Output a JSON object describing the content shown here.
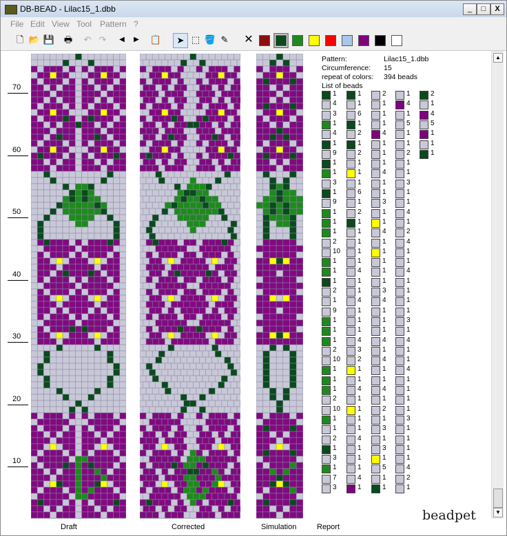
{
  "window": {
    "title": "DB-BEAD - Lilac15_1.dbb",
    "minimize": "_",
    "maximize": "□",
    "close": "X"
  },
  "menu": [
    "File",
    "Edit",
    "View",
    "Tool",
    "Pattern",
    "?"
  ],
  "toolbar": {
    "icons": [
      "new-file-icon",
      "open-folder-icon",
      "save-icon",
      "print-icon",
      "undo-icon",
      "redo-icon",
      "arrow-left-icon",
      "arrow-right-icon",
      "clipboard-icon",
      "pointer-icon",
      "select-rect-icon",
      "fill-bucket-icon",
      "color-picker-icon",
      "delete-icon"
    ],
    "palette": [
      "#8b0f0f",
      "#0a4a1e",
      "#1e8a1e",
      "#ffff00",
      "#ff0000",
      "#a9c7ee",
      "#800080",
      "#000000",
      "#ffffff"
    ],
    "selected_palette": 1
  },
  "ruler": {
    "labels": [
      "70",
      "60",
      "50",
      "40",
      "30",
      "20",
      "10"
    ]
  },
  "panels": {
    "draft": "Draft",
    "corrected": "Corrected",
    "simulation": "Simulation",
    "report": "Report"
  },
  "colors": {
    "background": "#c8c8d8",
    "grid": "#8a8aa0",
    "violet": "#800a80",
    "yellow": "#ffff00",
    "dark_green": "#0a4a1e",
    "green": "#1e8a1e"
  },
  "report": {
    "pattern_label": "Pattern:",
    "pattern_value": "Lilac15_1.dbb",
    "circumference_label": "Circumference:",
    "circumference_value": "15",
    "repeat_label": "repeat of colors:",
    "repeat_value": "394 beads",
    "list_label": "List of beads",
    "bead_columns": [
      [
        [
          "D",
          1
        ],
        [
          "L",
          4
        ],
        [
          "L",
          3
        ],
        [
          "G",
          1
        ],
        [
          "L",
          4
        ],
        [
          "D",
          1
        ],
        [
          "L",
          9
        ],
        [
          "D",
          1
        ],
        [
          "G",
          1
        ],
        [
          "L",
          3
        ],
        [
          "D",
          1
        ],
        [
          "L",
          9
        ],
        [
          "G",
          1
        ],
        [
          "G",
          1
        ],
        [
          "G",
          1
        ],
        [
          "L",
          2
        ],
        [
          "L",
          10
        ],
        [
          "G",
          1
        ],
        [
          "G",
          1
        ],
        [
          "D",
          1
        ],
        [
          "L",
          2
        ],
        [
          "L",
          1
        ],
        [
          "L",
          9
        ],
        [
          "G",
          1
        ],
        [
          "G",
          1
        ],
        [
          "G",
          1
        ],
        [
          "L",
          2
        ],
        [
          "L",
          10
        ],
        [
          "G",
          1
        ],
        [
          "G",
          1
        ],
        [
          "G",
          1
        ],
        [
          "L",
          2
        ],
        [
          "L",
          10
        ],
        [
          "G",
          1
        ],
        [
          "L",
          1
        ],
        [
          "L",
          2
        ],
        [
          "D",
          1
        ],
        [
          "L",
          3
        ],
        [
          "G",
          1
        ],
        [
          "L",
          7
        ],
        [
          "L",
          3
        ]
      ],
      [
        [
          "D",
          1
        ],
        [
          "L",
          1
        ],
        [
          "L",
          6
        ],
        [
          "D",
          1
        ],
        [
          "L",
          2
        ],
        [
          "D",
          1
        ],
        [
          "L",
          2
        ],
        [
          "L",
          1
        ],
        [
          "Y",
          1
        ],
        [
          "L",
          1
        ],
        [
          "L",
          6
        ],
        [
          "L",
          1
        ],
        [
          "L",
          2
        ],
        [
          "D",
          1
        ],
        [
          "L",
          1
        ],
        [
          "L",
          1
        ],
        [
          "L",
          1
        ],
        [
          "L",
          1
        ],
        [
          "L",
          4
        ],
        [
          "L",
          1
        ],
        [
          "L",
          1
        ],
        [
          "L",
          4
        ],
        [
          "L",
          1
        ],
        [
          "L",
          1
        ],
        [
          "L",
          1
        ],
        [
          "L",
          4
        ],
        [
          "L",
          3
        ],
        [
          "L",
          2
        ],
        [
          "Y",
          1
        ],
        [
          "L",
          1
        ],
        [
          "L",
          4
        ],
        [
          "L",
          1
        ],
        [
          "Y",
          1
        ],
        [
          "L",
          1
        ],
        [
          "L",
          1
        ],
        [
          "L",
          4
        ],
        [
          "L",
          1
        ],
        [
          "L",
          1
        ],
        [
          "L",
          1
        ],
        [
          "L",
          4
        ],
        [
          "P",
          1
        ]
      ],
      [
        [
          "L",
          2
        ],
        [
          "L",
          1
        ],
        [
          "L",
          1
        ],
        [
          "L",
          1
        ],
        [
          "P",
          4
        ],
        [
          "L",
          1
        ],
        [
          "L",
          1
        ],
        [
          "L",
          1
        ],
        [
          "L",
          4
        ],
        [
          "L",
          1
        ],
        [
          "L",
          1
        ],
        [
          "L",
          3
        ],
        [
          "L",
          1
        ],
        [
          "Y",
          1
        ],
        [
          "L",
          4
        ],
        [
          "L",
          1
        ],
        [
          "Y",
          1
        ],
        [
          "L",
          1
        ],
        [
          "L",
          1
        ],
        [
          "L",
          1
        ],
        [
          "L",
          3
        ],
        [
          "L",
          4
        ],
        [
          "L",
          1
        ],
        [
          "L",
          1
        ],
        [
          "L",
          1
        ],
        [
          "L",
          4
        ],
        [
          "L",
          1
        ],
        [
          "L",
          4
        ],
        [
          "L",
          1
        ],
        [
          "L",
          1
        ],
        [
          "L",
          4
        ],
        [
          "L",
          1
        ],
        [
          "L",
          2
        ],
        [
          "L",
          1
        ],
        [
          "L",
          3
        ],
        [
          "L",
          1
        ],
        [
          "L",
          3
        ],
        [
          "Y",
          1
        ],
        [
          "L",
          5
        ],
        [
          "L",
          1
        ],
        [
          "D",
          1
        ]
      ],
      [
        [
          "L",
          1
        ],
        [
          "P",
          4
        ],
        [
          "L",
          1
        ],
        [
          "L",
          5
        ],
        [
          "L",
          1
        ],
        [
          "L",
          1
        ],
        [
          "L",
          2
        ],
        [
          "L",
          1
        ],
        [
          "L",
          1
        ],
        [
          "L",
          3
        ],
        [
          "L",
          1
        ],
        [
          "L",
          1
        ],
        [
          "L",
          4
        ],
        [
          "L",
          1
        ],
        [
          "L",
          2
        ],
        [
          "L",
          4
        ],
        [
          "L",
          1
        ],
        [
          "L",
          1
        ],
        [
          "L",
          4
        ],
        [
          "L",
          1
        ],
        [
          "L",
          1
        ],
        [
          "L",
          1
        ],
        [
          "L",
          1
        ],
        [
          "L",
          3
        ],
        [
          "L",
          1
        ],
        [
          "L",
          4
        ],
        [
          "L",
          1
        ],
        [
          "L",
          1
        ],
        [
          "L",
          4
        ],
        [
          "L",
          1
        ],
        [
          "L",
          1
        ],
        [
          "L",
          1
        ],
        [
          "L",
          1
        ],
        [
          "L",
          3
        ],
        [
          "L",
          1
        ],
        [
          "L",
          1
        ],
        [
          "L",
          1
        ],
        [
          "L",
          1
        ],
        [
          "L",
          4
        ],
        [
          "L",
          2
        ],
        [
          "L",
          1
        ]
      ],
      [
        [
          "D",
          2
        ],
        [
          "L",
          1
        ],
        [
          "P",
          4
        ],
        [
          "L",
          5
        ],
        [
          "P",
          1
        ],
        [
          "L",
          1
        ],
        [
          "D",
          1
        ]
      ]
    ],
    "bead_colors": {
      "D": "#0a4a1e",
      "G": "#1e8a1e",
      "L": "#c8c8d8",
      "P": "#800080",
      "Y": "#ffff00"
    }
  }
}
